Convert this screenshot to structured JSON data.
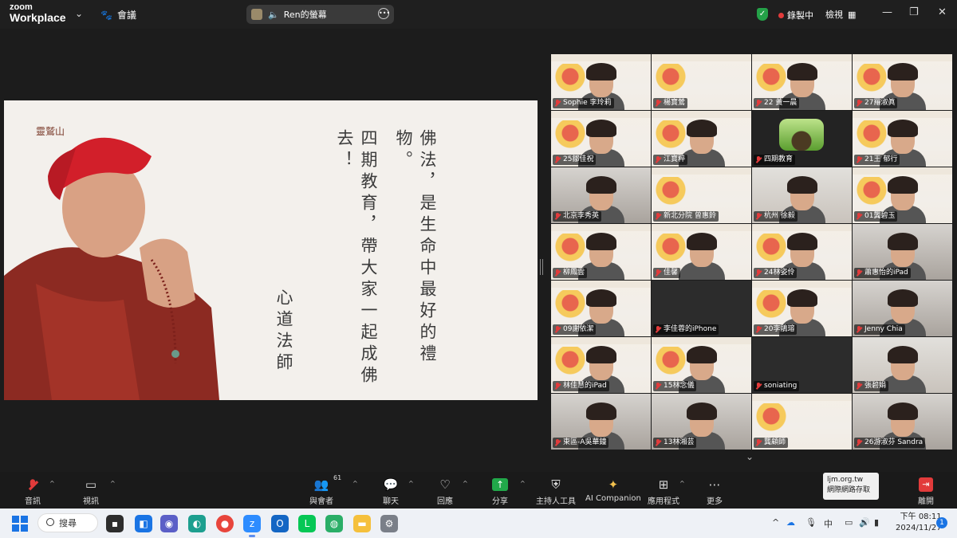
{
  "titlebar": {
    "logo_line1": "zoom",
    "logo_line2": "Workplace",
    "meeting_label": "會議",
    "share_label": "Ren的螢幕",
    "recording_label": "錄製中",
    "view_label": "檢視"
  },
  "slide": {
    "logo_text": "靈鷲山",
    "line1": "佛法，是生命中最好的禮物。",
    "line2": "四期教育，帶大家一起成佛去！",
    "signature": "心道法師"
  },
  "gallery": {
    "tiles": [
      {
        "name": "Sophie  李玲莉",
        "bg": "poster",
        "face": true,
        "speaking": true
      },
      {
        "name": "楊寶鶯",
        "bg": "poster",
        "face": false
      },
      {
        "name": "22 黃一晨",
        "bg": "poster",
        "face": true
      },
      {
        "name": "27羅淑眞",
        "bg": "poster",
        "face": true
      },
      {
        "name": "25鄒佳祝",
        "bg": "poster",
        "face": true
      },
      {
        "name": "江寶粹",
        "bg": "poster",
        "face": true
      },
      {
        "name": "四期教育",
        "bg": "plant",
        "face": false
      },
      {
        "name": "21王 郁行",
        "bg": "poster",
        "face": true
      },
      {
        "name": "北京李秀英",
        "bg": "room",
        "face": true
      },
      {
        "name": "新北分院 曾惠鈴",
        "bg": "poster",
        "face": false
      },
      {
        "name": "杭州 徐毅",
        "bg": "wall",
        "face": true
      },
      {
        "name": "01龔碧玉",
        "bg": "poster",
        "face": true
      },
      {
        "name": "柳鳳雲",
        "bg": "poster",
        "face": true
      },
      {
        "name": "佳馨",
        "bg": "poster",
        "face": true
      },
      {
        "name": "24林姿伶",
        "bg": "poster",
        "face": true
      },
      {
        "name": "蕭惠怡的iPad",
        "bg": "room",
        "face": true
      },
      {
        "name": "09謝依潔",
        "bg": "poster",
        "face": true
      },
      {
        "name": "李佳蓉的iPhone",
        "bg": "dark",
        "face": false
      },
      {
        "name": "20李鵑瑢",
        "bg": "poster",
        "face": true
      },
      {
        "name": "Jenny Chia",
        "bg": "room",
        "face": true
      },
      {
        "name": "林佳慧的iPad",
        "bg": "poster",
        "face": true
      },
      {
        "name": "15林念儀",
        "bg": "poster",
        "face": true
      },
      {
        "name": "soniating",
        "bg": "dark",
        "face": false
      },
      {
        "name": "張碧娟",
        "bg": "wall",
        "face": true
      },
      {
        "name": "東區-A吳華鐘",
        "bg": "room",
        "face": true
      },
      {
        "name": "13林湘芸",
        "bg": "room",
        "face": true
      },
      {
        "name": "龔顧師",
        "bg": "poster",
        "face": false
      },
      {
        "name": "26游淑芬 Sandra",
        "bg": "room",
        "face": true
      }
    ]
  },
  "toolbar": {
    "audio": "音訊",
    "video": "視訊",
    "participants": "與會者",
    "participants_count": "61",
    "chat": "聊天",
    "react": "回應",
    "share": "分享",
    "host_tools": "主持人工具",
    "ai_companion": "AI Companion",
    "apps": "應用程式",
    "more": "更多",
    "leave": "離開",
    "tooltip_line1": "ljm.org.tw",
    "tooltip_line2": "網際網路存取"
  },
  "taskbar": {
    "search": "搜尋",
    "ime": "中",
    "time": "下午 08:11",
    "date": "2024/11/27",
    "notifications": "1"
  },
  "colors": {
    "speaker_outline": "#2bd566",
    "recording_dot": "#e23b3b",
    "share_green": "#21a84a"
  }
}
